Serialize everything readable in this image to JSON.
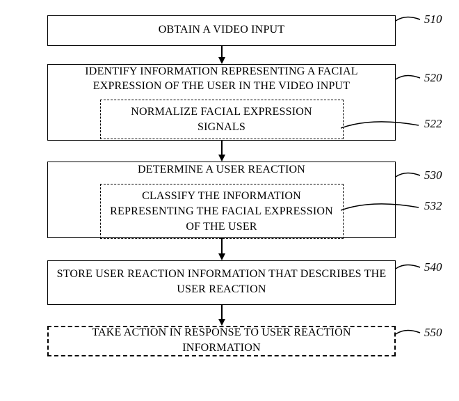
{
  "steps": {
    "s510": {
      "text": "OBTAIN A VIDEO INPUT",
      "label": "510"
    },
    "s520": {
      "text": "IDENTIFY INFORMATION REPRESENTING A FACIAL EXPRESSION OF THE USER IN THE VIDEO INPUT",
      "label": "520",
      "inner": {
        "text": "NORMALIZE FACIAL EXPRESSION SIGNALS",
        "label": "522"
      }
    },
    "s530": {
      "text": "DETERMINE A USER REACTION",
      "label": "530",
      "inner": {
        "text": "CLASSIFY THE INFORMATION REPRESENTING THE FACIAL EXPRESSION OF THE USER",
        "label": "532"
      }
    },
    "s540": {
      "text": "STORE USER REACTION INFORMATION THAT DESCRIBES THE USER REACTION",
      "label": "540"
    },
    "s550": {
      "text": "TAKE ACTION IN RESPONSE TO USER REACTION INFORMATION",
      "label": "550"
    }
  }
}
